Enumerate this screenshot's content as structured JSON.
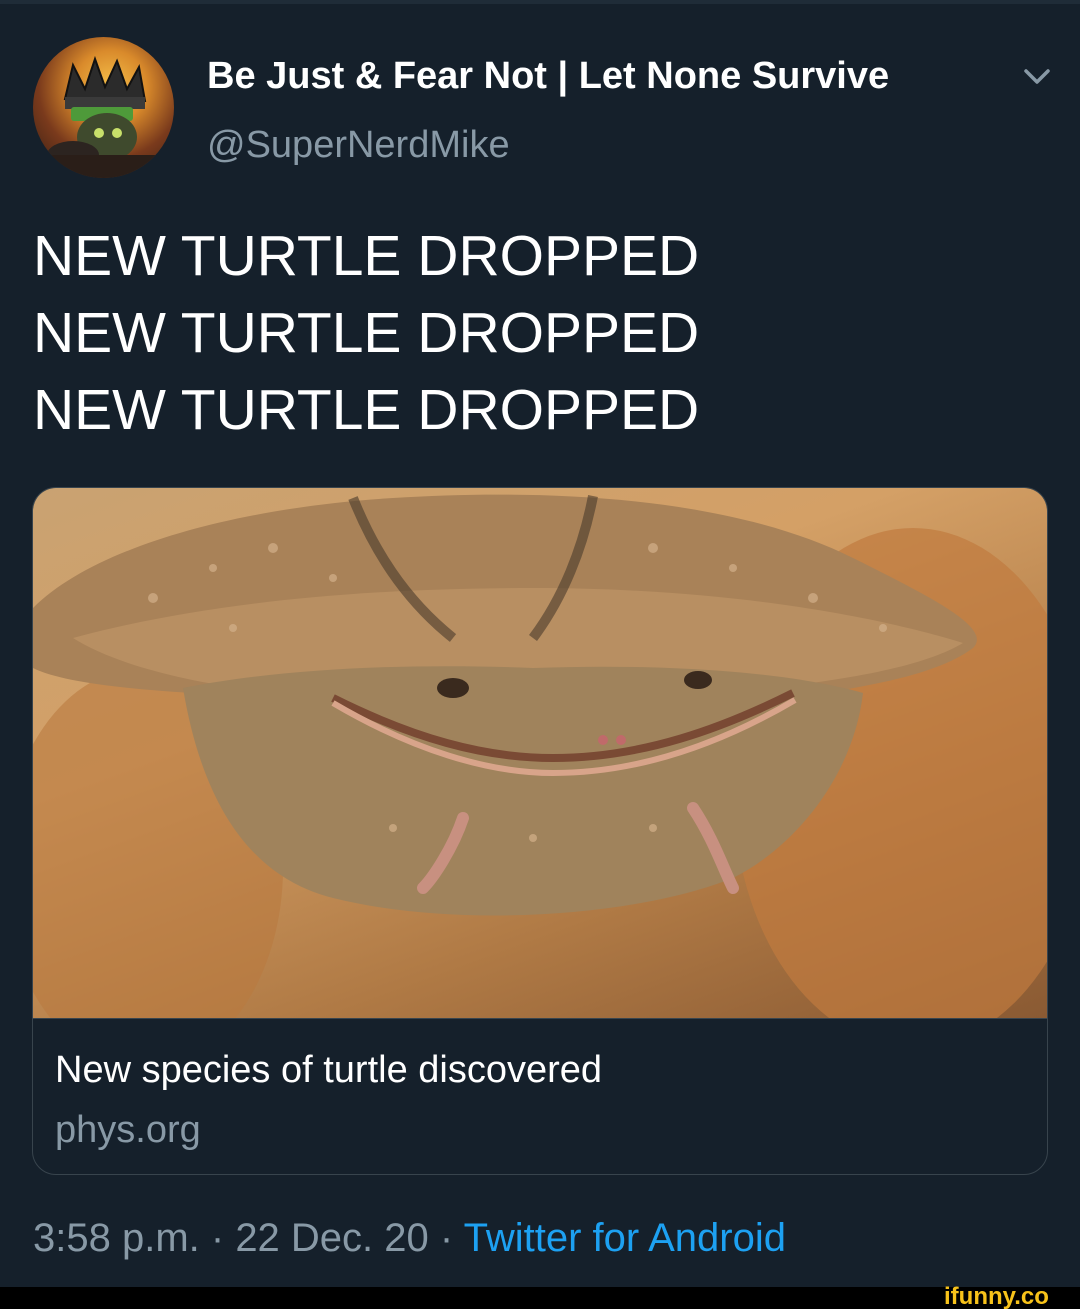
{
  "colors": {
    "background": "#15202b",
    "text_primary": "#ffffff",
    "text_secondary": "#8899a6",
    "link": "#1da1f2",
    "border": "#38444d",
    "watermark": "#f7c21a"
  },
  "author": {
    "display_name": "Be Just & Fear Not | Let None Survive",
    "handle": "@SuperNerdMike",
    "avatar_icon": "avatar-icon"
  },
  "menu": {
    "icon": "chevron-down-icon"
  },
  "tweet": {
    "lines": [
      "NEW TURTLE DROPPED",
      "NEW TURTLE DROPPED",
      "NEW TURTLE DROPPED"
    ]
  },
  "link_card": {
    "image_icon": "turtle-photo",
    "title": "New species of turtle discovered",
    "domain": "phys.org"
  },
  "meta": {
    "time": "3:58 p.m.",
    "separator": " · ",
    "date": "22 Dec. 20",
    "source": "Twitter for Android"
  },
  "watermark": {
    "text": "ifunny.co"
  }
}
